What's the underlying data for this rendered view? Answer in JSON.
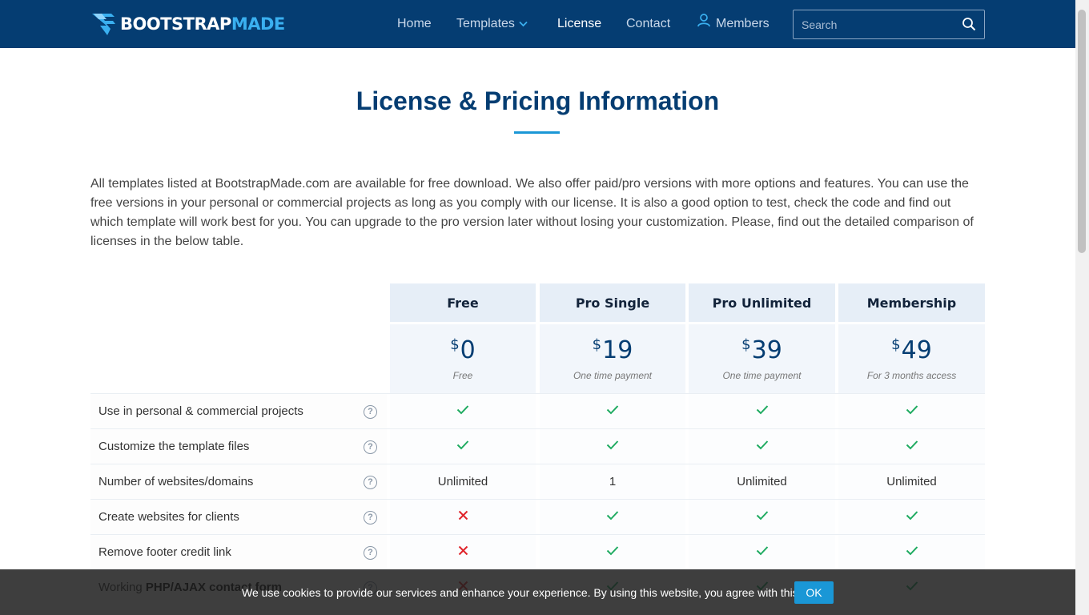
{
  "header": {
    "logo": {
      "part1": "BOOTSTRAP",
      "part2": "MADE"
    },
    "nav": {
      "home": "Home",
      "templates": "Templates",
      "license": "License",
      "contact": "Contact",
      "members": "Members"
    },
    "search": {
      "placeholder": "Search",
      "value": ""
    }
  },
  "main": {
    "title": "License & Pricing Information",
    "intro": "All templates listed at BootstrapMade.com are available for free download. We also offer paid/pro versions with more options and features. You can use the free versions in your personal or commercial projects as long as you comply with our license. It is also a good option to test, check the code and find out which template will work best for you. You can upgrade to the pro version later without losing your customization. Please, find out the detailed comparison of licenses in the below table."
  },
  "pricing": {
    "currency": "$",
    "plans": [
      {
        "name": "Free",
        "price": "0",
        "note": "Free"
      },
      {
        "name": "Pro Single",
        "price": "19",
        "note": "One time payment"
      },
      {
        "name": "Pro Unlimited",
        "price": "39",
        "note": "One time payment"
      },
      {
        "name": "Membership",
        "price": "49",
        "note": "For 3 months access"
      }
    ],
    "features": [
      {
        "label": "Use in personal & commercial projects",
        "values": [
          "check",
          "check",
          "check",
          "check"
        ]
      },
      {
        "label": "Customize the template files",
        "values": [
          "check",
          "check",
          "check",
          "check"
        ]
      },
      {
        "label": "Number of websites/domains",
        "values": [
          "Unlimited",
          "1",
          "Unlimited",
          "Unlimited"
        ]
      },
      {
        "label": "Create websites for clients",
        "values": [
          "cross",
          "check",
          "check",
          "check"
        ]
      },
      {
        "label": "Remove footer credit link",
        "values": [
          "cross",
          "check",
          "check",
          "check"
        ]
      },
      {
        "label_prefix": "Working ",
        "label_bold": "PHP/AJAX contact form",
        "values": [
          "cross",
          "check",
          "check",
          "check"
        ]
      }
    ],
    "help_glyph": "?"
  },
  "cookie": {
    "text": "We use cookies to provide our services and enhance your experience. By using this website, you agree with this.",
    "ok": "OK"
  },
  "colors": {
    "header_bg": "#053d72",
    "accent": "#1a97d6",
    "check": "#1fab61",
    "cross": "#e0242b",
    "title": "#053d72"
  },
  "icons": {
    "check": "check-icon",
    "cross": "cross-icon",
    "help": "help-circle-icon",
    "search": "search-icon",
    "user": "user-icon",
    "chevron": "chevron-down-icon"
  }
}
